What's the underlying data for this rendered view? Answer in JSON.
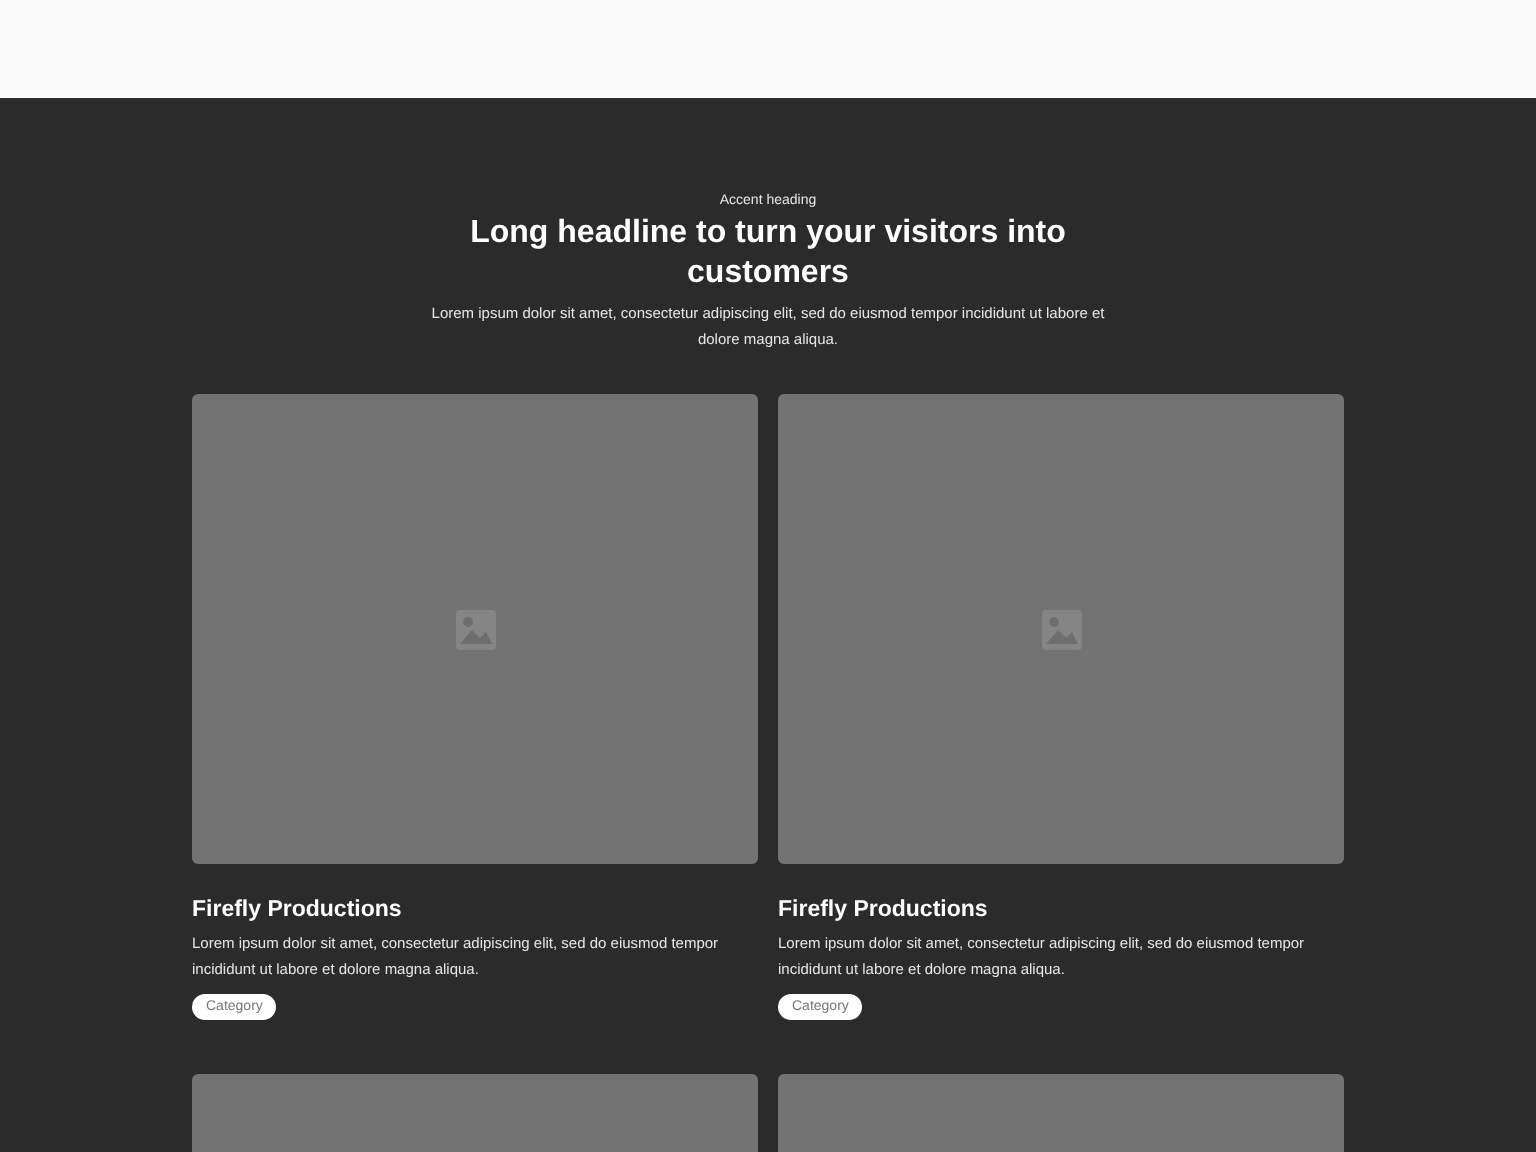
{
  "hero": {
    "accent": "Accent heading",
    "headline": "Long headline to turn your visitors into customers",
    "text": "Lorem ipsum dolor sit amet, consectetur adipiscing elit, sed do eiusmod tempor incididunt ut labore et dolore magna aliqua."
  },
  "cards": [
    {
      "kind": "full",
      "title": "Firefly Productions",
      "text": "Lorem ipsum dolor sit amet, consectetur adipiscing elit, sed do eiusmod tempor incididunt ut labore et dolore magna aliqua.",
      "tag": "Category"
    },
    {
      "kind": "full",
      "title": "Firefly Productions",
      "text": "Lorem ipsum dolor sit amet, consectetur adipiscing elit, sed do eiusmod tempor incididunt ut labore et dolore magna aliqua.",
      "tag": "Category"
    },
    {
      "kind": "cut"
    },
    {
      "kind": "cut"
    }
  ]
}
